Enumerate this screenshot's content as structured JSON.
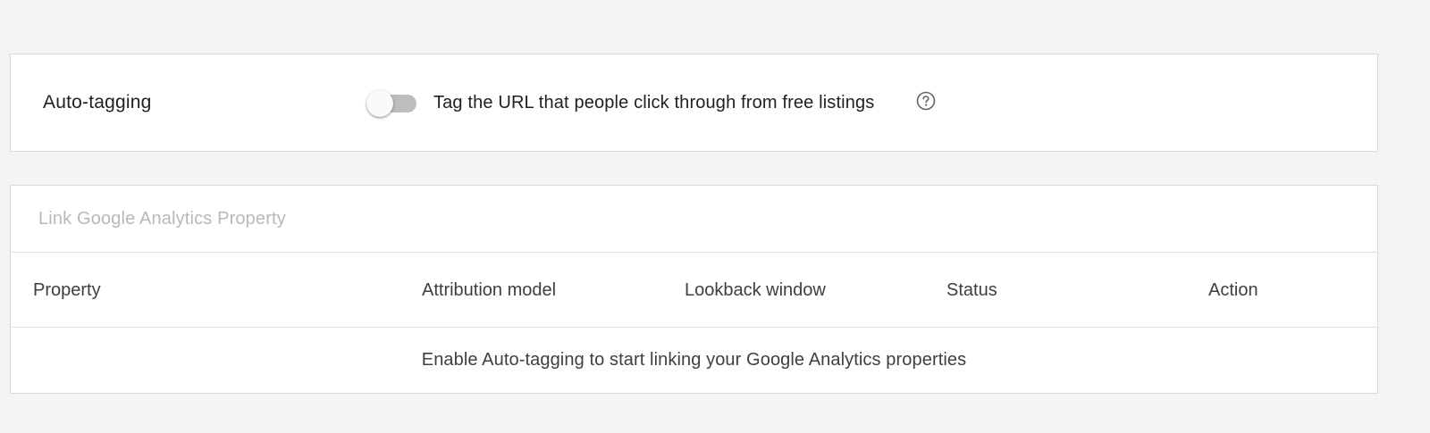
{
  "auto_tagging": {
    "title": "Auto-tagging",
    "toggle_state": "off",
    "toggle_label": "Tag the URL that people click through from free listings",
    "help_icon": "help-circle-icon"
  },
  "link_analytics": {
    "title": "Link Google Analytics Property",
    "columns": [
      "Property",
      "Attribution model",
      "Lookback window",
      "Status",
      "Action"
    ],
    "empty_message": "Enable Auto-tagging to start linking your Google Analytics properties"
  },
  "colors": {
    "background": "#f4f4f4",
    "card": "#ffffff",
    "toggle_track_off": "#bdbdbd",
    "muted_title": "#b8b8b8"
  }
}
